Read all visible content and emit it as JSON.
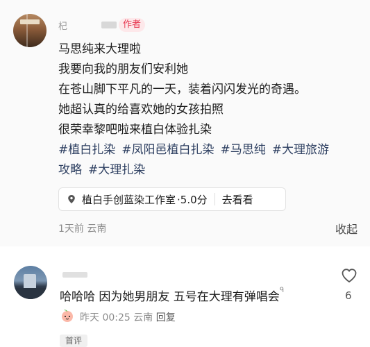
{
  "post": {
    "username": "杞",
    "author_badge": "作者",
    "lines": [
      "马思纯来大理啦",
      "我要向我的朋友们安利她",
      "在苍山脚下平凡的一天，装着闪闪发光的奇遇。",
      "她超认真的给喜欢她的女孩拍照",
      "很荣幸黎吧啦来植白体验扎染"
    ],
    "tags_line1": [
      "#植白扎染",
      "#凤阳邑植白扎染",
      "#马思纯",
      "#大理旅游"
    ],
    "tags_line2": [
      "攻略",
      "#大理扎染"
    ],
    "location": {
      "icon": "location-pin-icon",
      "name": "植白手创蓝染工作室",
      "rating": "·5.0分",
      "action": "去看看"
    },
    "time": "1天前",
    "region": "云南",
    "collapse_label": "收起"
  },
  "comment": {
    "text": "哈哈哈 因为她男朋友 五号在大理有弹唱会",
    "search_glyph": "ᑫ",
    "time": "昨天 00:25",
    "region": "云南",
    "reply_label": "回复",
    "like_count": "6",
    "badge": "首评"
  },
  "colors": {
    "author_badge_bg": "#fde8ea",
    "author_badge_text": "#e8364f",
    "tag_text": "#2c3e60",
    "meta_text": "#8c8c8c"
  }
}
